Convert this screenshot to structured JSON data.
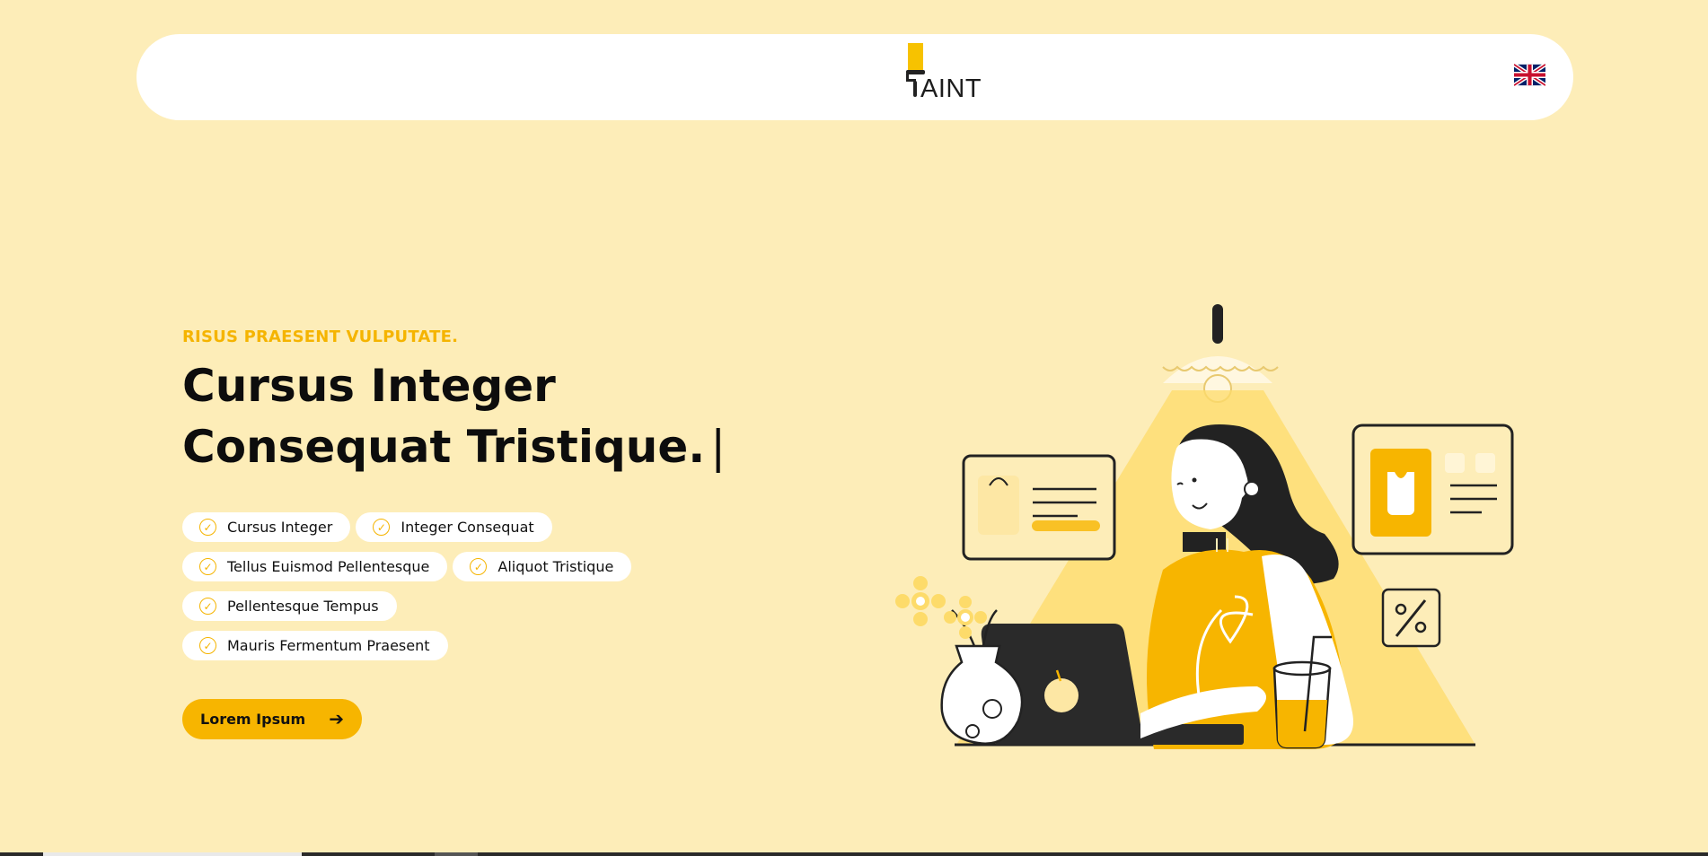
{
  "header": {
    "logo_text": "AINT",
    "language_icon": "uk-flag-icon"
  },
  "hero": {
    "eyebrow": "RISUS PRAESENT VULPUTATE.",
    "headline_line1": "Cursus Integer",
    "headline_line2": "Consequat Tristique.",
    "caret": "|",
    "tags": [
      [
        "Cursus Integer",
        "Integer Consequat"
      ],
      [
        "Tellus Euismod Pellentesque",
        "Aliquot Tristique"
      ],
      [
        "Pellentesque Tempus"
      ],
      [
        "Mauris Fermentum Praesent"
      ]
    ],
    "cta_label": "Lorem Ipsum",
    "cta_icon": "arrow-right-icon"
  },
  "colors": {
    "background": "#fdedb8",
    "accent": "#f7b500",
    "header_bg": "#ffffff",
    "text": "#111111"
  }
}
